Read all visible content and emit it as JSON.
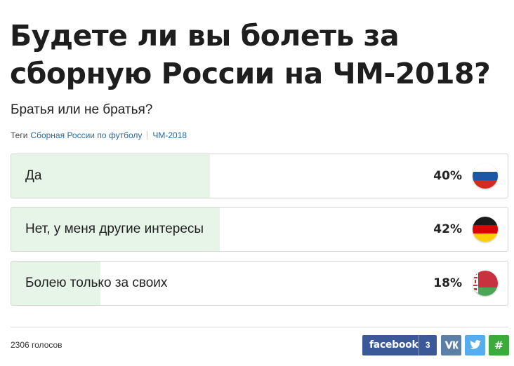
{
  "poll": {
    "title": "Будете ли вы болеть за сборную России на ЧМ-2018?",
    "subtitle": "Братья или не братья?",
    "tags_label": "Теги",
    "tags": [
      "Сборная России по футболу",
      "ЧМ-2018"
    ],
    "options": [
      {
        "label": "Да",
        "percent_text": "40%",
        "percent": 40,
        "flag": "russia-flag-icon"
      },
      {
        "label": "Нет, у меня другие интересы",
        "percent_text": "42%",
        "percent": 42,
        "flag": "germany-flag-icon"
      },
      {
        "label": "Болею только за своих",
        "percent_text": "18%",
        "percent": 18,
        "flag": "belarus-flag-icon"
      }
    ],
    "votes": "2306 голосов"
  },
  "share": {
    "facebook_label": "facebook",
    "facebook_count": "3",
    "vk_icon": "vk-icon",
    "twitter_icon": "twitter-icon",
    "hash_label": "#"
  },
  "colors": {
    "result_fill": "#e6f5e8",
    "facebook": "#3b5998",
    "vk": "#5b7fa6",
    "twitter": "#55acee",
    "hash": "#3bab3b",
    "tag_link": "#2a6ba5"
  }
}
